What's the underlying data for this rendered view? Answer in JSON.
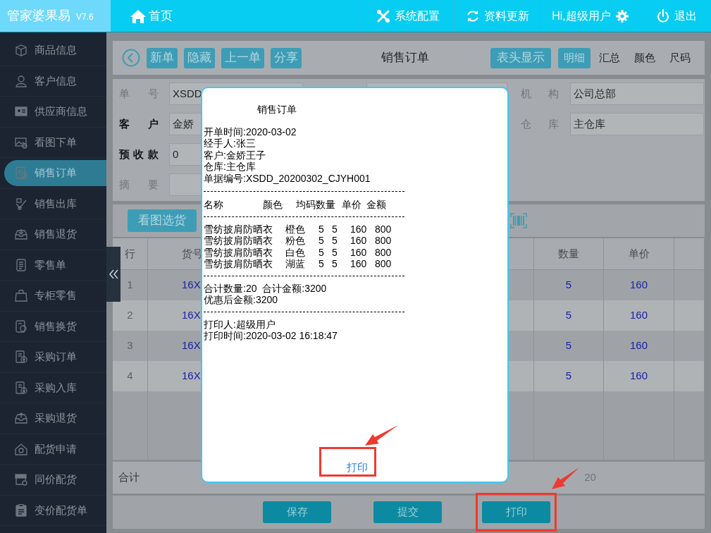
{
  "header": {
    "app_name": "管家婆果易",
    "version": "V7.6",
    "home": "首页",
    "actions": [
      {
        "kind": "settings",
        "label": "系统配置"
      },
      {
        "kind": "refresh",
        "label": "资料更新"
      },
      {
        "kind": "user",
        "label": "Hi,超级用户"
      },
      {
        "kind": "logout",
        "label": "退出"
      }
    ]
  },
  "sidebar": {
    "items": [
      {
        "label": "商品信息",
        "selected": false
      },
      {
        "label": "客户信息",
        "selected": false
      },
      {
        "label": "供应商信息",
        "selected": false
      },
      {
        "label": "看图下单",
        "selected": false
      },
      {
        "label": "销售订单",
        "selected": true
      },
      {
        "label": "销售出库",
        "selected": false
      },
      {
        "label": "销售退货",
        "selected": false
      },
      {
        "label": "零售单",
        "selected": false
      },
      {
        "label": "专柜零售",
        "selected": false
      },
      {
        "label": "销售换货",
        "selected": false
      },
      {
        "label": "采购订单",
        "selected": false
      },
      {
        "label": "采购入库",
        "selected": false
      },
      {
        "label": "采购退货",
        "selected": false
      },
      {
        "label": "配货申请",
        "selected": false
      },
      {
        "label": "同价配货",
        "selected": false
      },
      {
        "label": "变价配货单",
        "selected": false
      }
    ]
  },
  "toolbar": {
    "buttons": [
      "新单",
      "隐藏",
      "上一单",
      "分享"
    ],
    "title": "销售订单",
    "header_toggle": "表头显示",
    "tabs": [
      {
        "label": "明细",
        "selected": true
      },
      {
        "label": "汇总",
        "selected": false
      },
      {
        "label": "颜色",
        "selected": false
      },
      {
        "label": "尺码",
        "selected": false
      }
    ]
  },
  "form": {
    "left": [
      {
        "label": "单 号",
        "value": "XSDD",
        "required": false
      },
      {
        "label": "客 户",
        "value": "金娇",
        "required": true
      },
      {
        "label": "预 收 款",
        "value": "0",
        "required": true
      },
      {
        "label": "摘 要",
        "required": false
      }
    ],
    "right": [
      {
        "label": "机 构",
        "value": "公司总部"
      },
      {
        "label": "仓 库",
        "value": "主仓库"
      }
    ]
  },
  "pick_button": "看图选货",
  "table": {
    "columns": [
      "行",
      "货号",
      "数量",
      "单价"
    ],
    "rows": [
      {
        "line": "1",
        "item_no": "16X",
        "quantity": "5",
        "price": "160"
      },
      {
        "line": "2",
        "item_no": "16X",
        "quantity": "5",
        "price": "160"
      },
      {
        "line": "3",
        "item_no": "16X",
        "quantity": "5",
        "price": "160"
      },
      {
        "line": "4",
        "item_no": "16X",
        "quantity": "5",
        "price": "160"
      }
    ],
    "total": {
      "label": "合计",
      "quantity": "20"
    }
  },
  "footer_buttons": [
    {
      "label": "保存",
      "highlighted": false
    },
    {
      "label": "提交",
      "highlighted": false
    },
    {
      "label": "打印",
      "highlighted": true
    }
  ],
  "dialog": {
    "title": "销售订单",
    "header_lines": [
      "开单时间:2020-03-02",
      "经手人:张三",
      "客户:金娇王子",
      "仓库:主仓库",
      "单据编号:XSDD_20200302_CJYH001"
    ],
    "columns": [
      "名称",
      "颜色",
      "均码数量",
      "单价",
      "金额"
    ],
    "items": [
      {
        "name": "雪纺披肩防晒衣",
        "color_name": "橙色",
        "size": "5",
        "quantity": "5",
        "price": "160",
        "amount": "800"
      },
      {
        "name": "雪纺披肩防晒衣",
        "color_name": "粉色",
        "size": "5",
        "quantity": "5",
        "price": "160",
        "amount": "800"
      },
      {
        "name": "雪纺披肩防晒衣",
        "color_name": "白色",
        "size": "5",
        "quantity": "5",
        "price": "160",
        "amount": "800"
      },
      {
        "name": "雪纺披肩防晒衣",
        "color_name": "湖蓝",
        "size": "5",
        "quantity": "5",
        "price": "160",
        "amount": "800"
      }
    ],
    "summary_lines": [
      "合计数量:20  合计金额:3200",
      "优惠后金额:3200"
    ],
    "footer_lines": [
      "打印人:超级用户",
      "打印时间:2020-03-02 16:18:47"
    ],
    "print_button": {
      "label": "打印",
      "highlighted": true
    }
  }
}
